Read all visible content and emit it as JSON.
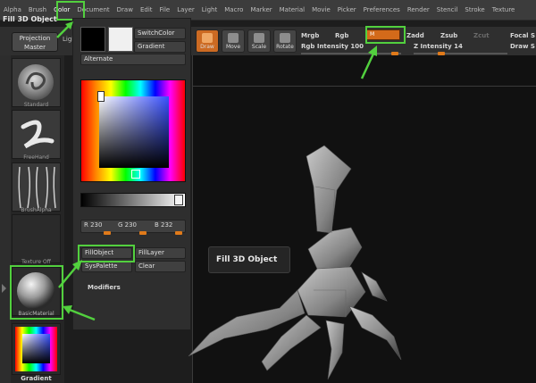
{
  "menubar": {
    "items": [
      "Alpha",
      "Brush",
      "Color",
      "Document",
      "Draw",
      "Edit",
      "File",
      "Layer",
      "Light",
      "Macro",
      "Marker",
      "Material",
      "Movie",
      "Picker",
      "Preferences",
      "Render",
      "Stencil",
      "Stroke",
      "Texture"
    ]
  },
  "document": {
    "title": "Fill 3D Object"
  },
  "topbar": {
    "projection_line1": "Projection",
    "projection_line2": "Master",
    "light_label": "Ligh",
    "tools": [
      {
        "label": "Draw"
      },
      {
        "label": "Move"
      },
      {
        "label": "Scale"
      },
      {
        "label": "Rotate"
      }
    ],
    "mrgb_label": "Mrgb",
    "rgb_label": "Rgb",
    "m_label": "M",
    "zadd_label": "Zadd",
    "zsub_label": "Zsub",
    "zcut_label": "Zcut",
    "focal_label": "Focal S",
    "draw_label": "Draw S",
    "rgb_intensity_label": "Rgb Intensity 100",
    "rgb_intensity_value": 100,
    "z_intensity_label": "Z Intensity 14",
    "z_intensity_value": 14
  },
  "left_shelf": {
    "items": [
      {
        "label": "Standard"
      },
      {
        "label": "FreeHand"
      },
      {
        "label": "BrushAlpha"
      },
      {
        "label": "Texture Off"
      },
      {
        "label": "BasicMaterial"
      },
      {
        "label": "Gradient"
      }
    ]
  },
  "color_palette": {
    "switch_color": "SwitchColor",
    "gradient": "Gradient",
    "alternate": "Alternate",
    "r_label": "R 230",
    "g_label": "G 230",
    "b_label": "B 232",
    "r_value": 230,
    "g_value": 230,
    "b_value": 232,
    "fill_object": "FillObject",
    "fill_layer": "FillLayer",
    "sys_palette": "SysPalette",
    "clear": "Clear",
    "modifiers": "Modifiers",
    "main_color": "#000000",
    "secondary_color": "#f0f0f0"
  },
  "tooltip": {
    "text": "Fill 3D Object"
  },
  "colors": {
    "highlight": "#52d03e",
    "accent": "#e07a1a"
  }
}
